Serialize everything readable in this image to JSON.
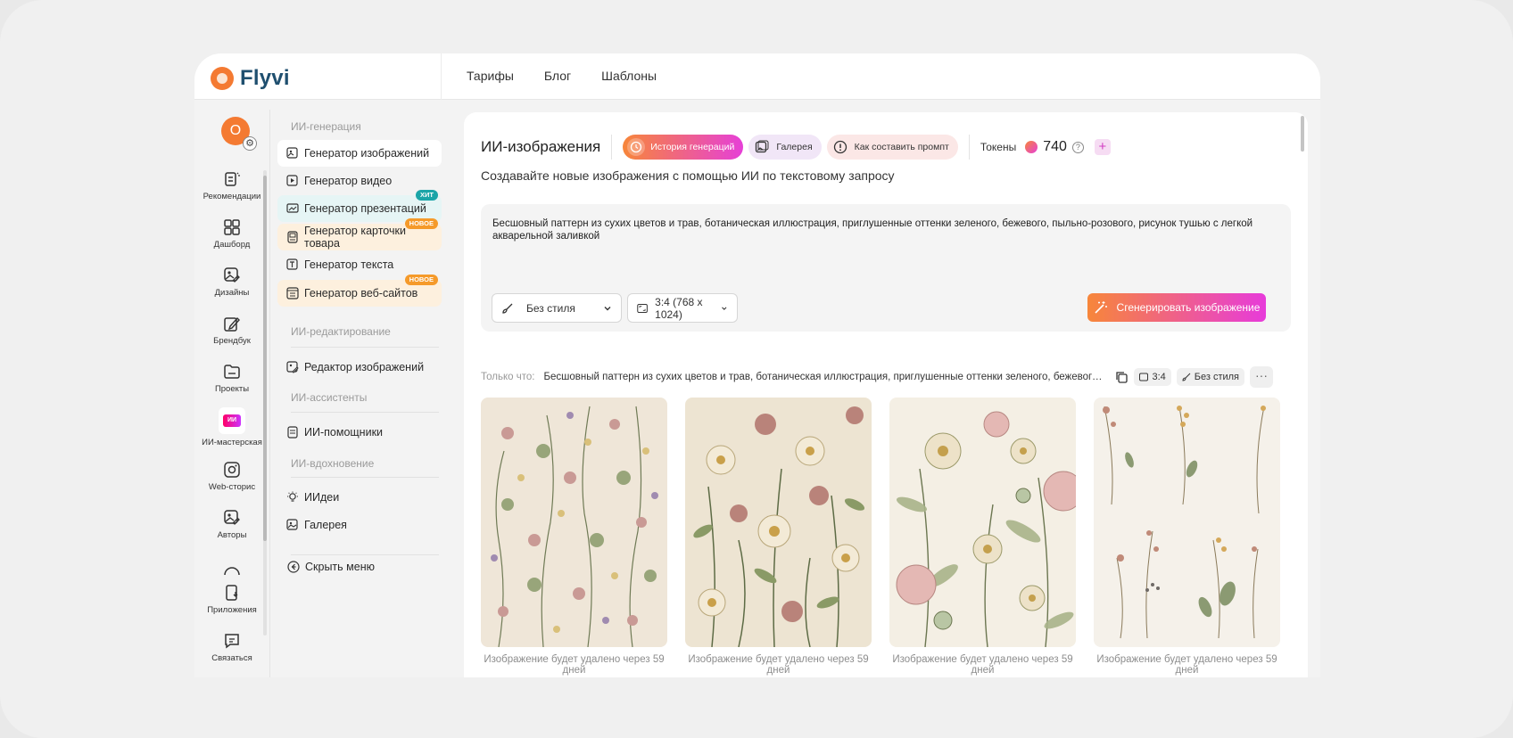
{
  "logo": {
    "name": "Flyvi"
  },
  "topnav": [
    "Тарифы",
    "Блог",
    "Шаблоны"
  ],
  "avatar": {
    "initial": "О"
  },
  "rail": [
    {
      "label": "Рекомендации",
      "icon": "recommendations-icon"
    },
    {
      "label": "Дашборд",
      "icon": "dashboard-icon"
    },
    {
      "label": "Дизайны",
      "icon": "designs-icon"
    },
    {
      "label": "Брендбук",
      "icon": "brandbook-icon"
    },
    {
      "label": "Проекты",
      "icon": "folder-icon"
    },
    {
      "label": "ИИ-мастерская",
      "icon": "ai-workshop-icon",
      "badge": "ИИ"
    },
    {
      "label": "Web-сторис",
      "icon": "web-stories-icon"
    },
    {
      "label": "Авторы",
      "icon": "authors-icon"
    },
    {
      "label": "Приложения",
      "icon": "apps-icon"
    },
    {
      "label": "Связаться",
      "icon": "contact-icon"
    }
  ],
  "menu": {
    "sections": [
      {
        "title": "ИИ-генерация"
      },
      {
        "title": "ИИ-редактирование"
      },
      {
        "title": "ИИ-ассистенты"
      },
      {
        "title": "ИИ-вдохновение"
      }
    ],
    "items": [
      {
        "label": "Генератор изображений",
        "icon": "image-icon"
      },
      {
        "label": "Генератор видео",
        "icon": "video-icon"
      },
      {
        "label": "Генератор презентаций",
        "icon": "presentation-icon",
        "badge": "ХИТ"
      },
      {
        "label": "Генератор карточки товара",
        "icon": "product-card-icon",
        "badge": "НОВОЕ"
      },
      {
        "label": "Генератор текста",
        "icon": "text-icon"
      },
      {
        "label": "Генератор веб-сайтов",
        "icon": "website-icon",
        "badge": "НОВОЕ"
      },
      {
        "label": "Редактор изображений",
        "icon": "image-edit-icon"
      },
      {
        "label": "ИИ-помощники",
        "icon": "assistant-icon"
      },
      {
        "label": "ИИдеи",
        "icon": "lightbulb-icon"
      },
      {
        "label": "Галерея",
        "icon": "gallery-icon"
      }
    ],
    "hide_label": "Скрыть меню"
  },
  "main": {
    "title": "ИИ-изображения",
    "history_label": "История генераций",
    "gallery_label": "Галерея",
    "howto_label": "Как составить промпт",
    "tokens_label": "Токены",
    "tokens_value": "740",
    "subtitle": "Создавайте новые изображения с помощью ИИ по текстовому запросу",
    "prompt": "Бесшовный паттерн из сухих цветов и трав, ботаническая иллюстрация, приглушенные оттенки зеленого, бежевого, пыльно-розового, рисунок тушью с легкой акварельной заливкой",
    "style_value": "Без стиля",
    "ratio_value": "3:4 (768 x 1024)",
    "generate_label": "Сгенерировать изображение",
    "just_label": "Только что:",
    "just_text": "Бесшовный паттерн из сухих цветов и трав, ботаническая иллюстрация, приглушенные оттенки зеленого, бежевого...",
    "chip_ratio": "3:4",
    "chip_style": "Без стиля",
    "caption": "Изображение будет удалено через 59 дней"
  },
  "colors": {
    "accent_orange": "#f7863a",
    "accent_pink": "#e640d7",
    "brand_blue": "#1f4f6f"
  }
}
